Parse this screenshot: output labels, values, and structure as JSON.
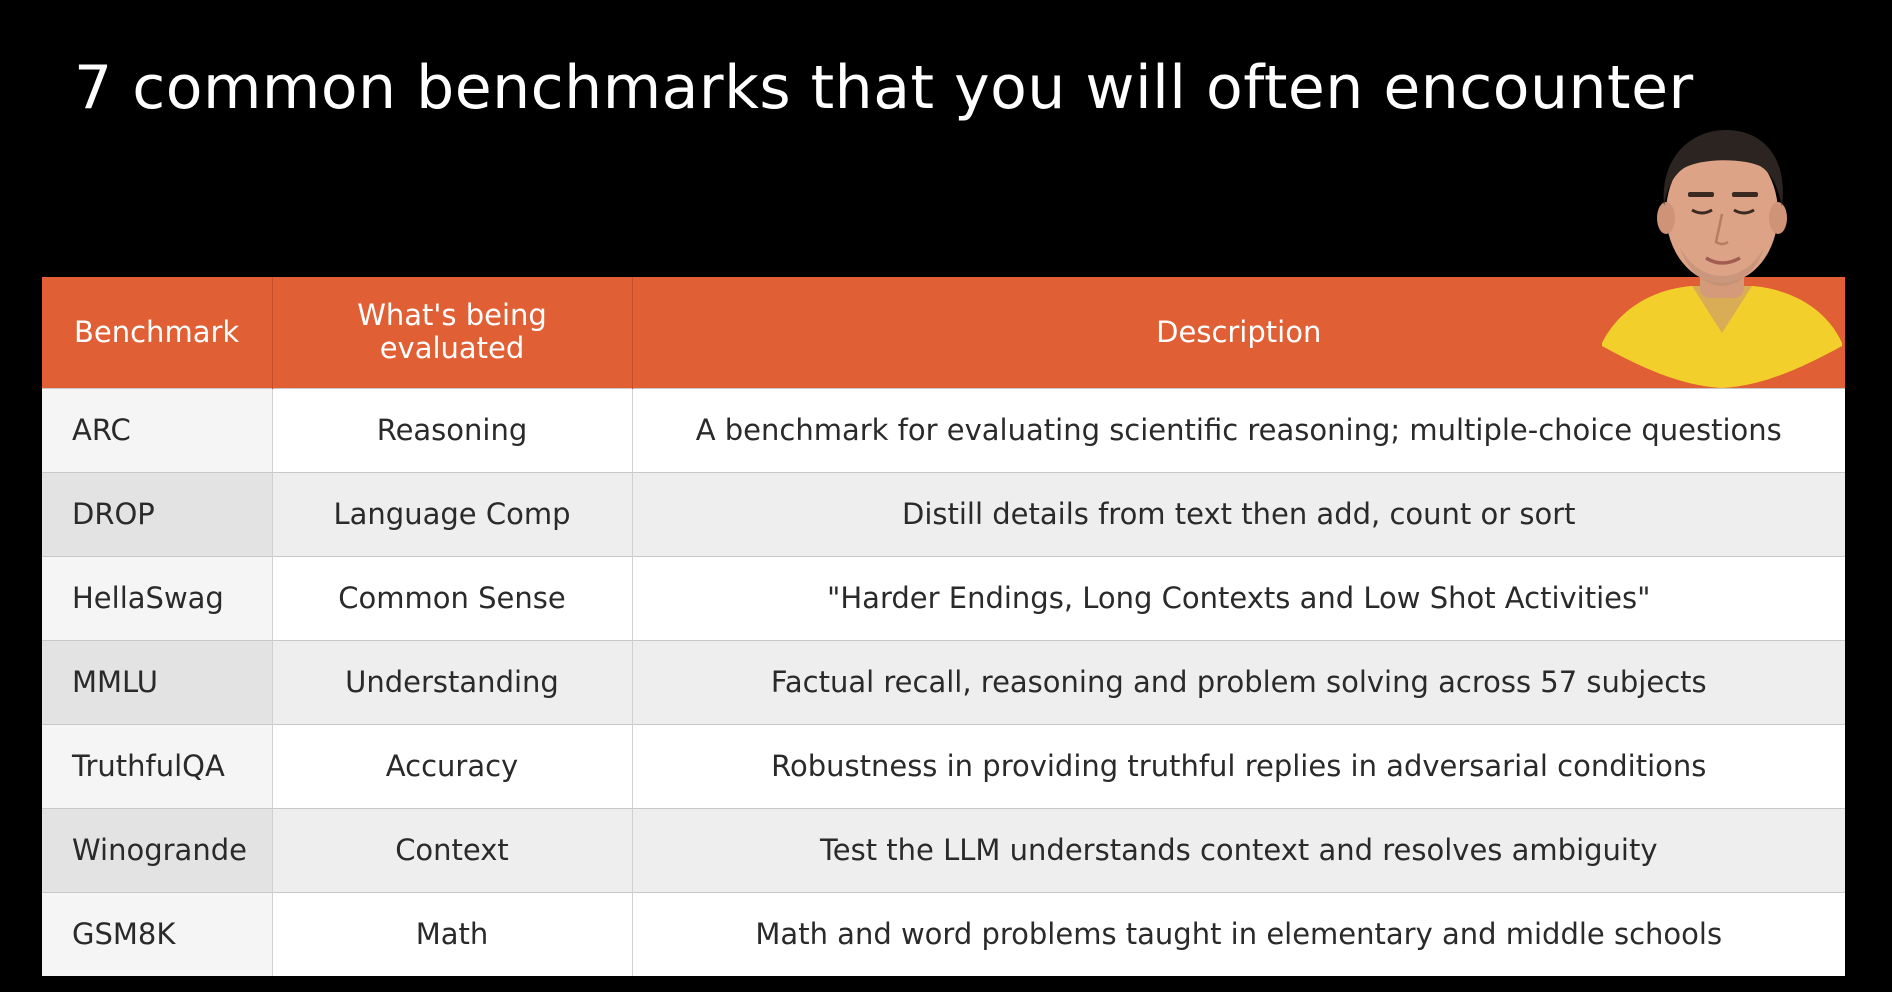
{
  "slide": {
    "title": "7 common benchmarks that you will often encounter"
  },
  "table": {
    "headers": {
      "benchmark": "Benchmark",
      "evaluated": "What's being evaluated",
      "description": "Description"
    },
    "rows": [
      {
        "benchmark": "ARC",
        "evaluated": "Reasoning",
        "description": "A benchmark for evaluating scientific reasoning; multiple-choice questions"
      },
      {
        "benchmark": "DROP",
        "evaluated": "Language Comp",
        "description": "Distill details from text then add, count or sort"
      },
      {
        "benchmark": "HellaSwag",
        "evaluated": "Common Sense",
        "description": "\"Harder Endings, Long Contexts and Low Shot Activities\""
      },
      {
        "benchmark": "MMLU",
        "evaluated": "Understanding",
        "description": "Factual recall, reasoning and problem solving across 57 subjects"
      },
      {
        "benchmark": "TruthfulQA",
        "evaluated": "Accuracy",
        "description": "Robustness in providing truthful replies in adversarial conditions"
      },
      {
        "benchmark": "Winogrande",
        "evaluated": "Context",
        "description": "Test the LLM understands context and resolves ambiguity"
      },
      {
        "benchmark": "GSM8K",
        "evaluated": "Math",
        "description": "Math and word problems taught in elementary and middle schools"
      }
    ]
  },
  "colors": {
    "background": "#000000",
    "header_accent": "#e15f34",
    "title_text": "#ffffff"
  },
  "icons": {
    "presenter": "presenter-webcam-overlay"
  }
}
